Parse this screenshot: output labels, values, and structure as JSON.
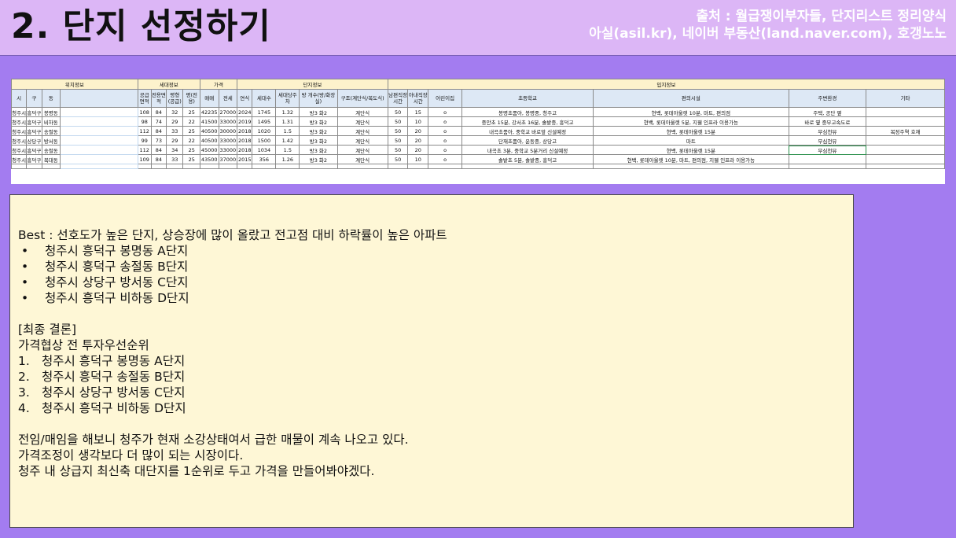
{
  "header": {
    "title": "2. 단지 선정하기",
    "source_line1": "출처 : 월급쟁이부자들, 단지리스트 정리양식",
    "source_line2": "아실(asil.kr), 네이버 부동산(land.naver.com), 호갱노노"
  },
  "table": {
    "group_headers": [
      "위치정보",
      "세대정보",
      "가격",
      "단지정보",
      "입지정보"
    ],
    "columns": [
      "시",
      "구",
      "동",
      "",
      "공급면적",
      "전용면적",
      "평형(공급)",
      "평(전용)",
      "매매",
      "전세",
      "연식",
      "세대수",
      "세대당주차",
      "방 개수(방/화장실)",
      "구조(계단식/복도식)",
      "남편직장시간",
      "아내직장시간",
      "어린이집",
      "초등학교",
      "편의시설",
      "주변환경",
      "기타"
    ],
    "rows": [
      [
        "청주시",
        "흥덕구",
        "봉명동",
        "",
        "108",
        "84",
        "32",
        "25",
        "42235",
        "27000",
        "2024",
        "1745",
        "1.32",
        "방3 화2",
        "계단식",
        "50",
        "15",
        "o",
        "봉명초품아, 봉명중, 청주고",
        "현백, 롯데아울렛 10분, 마트, 편의점",
        "주택, 공단 옆",
        ""
      ],
      [
        "청주시",
        "흥덕구",
        "비하동",
        "",
        "98",
        "74",
        "29",
        "22",
        "41500",
        "33000",
        "2019",
        "1495",
        "1.31",
        "방3 화2",
        "계단식",
        "50",
        "10",
        "o",
        "중안초 15분, 강서초 16분, 솔밭중, 흥덕고",
        "현백, 롯데아울렛 5분, 지웰 인프라 이용가능",
        "바로 옆 중부고속도로",
        ""
      ],
      [
        "청주시",
        "흥덕구",
        "송절동",
        "",
        "112",
        "84",
        "33",
        "25",
        "40500",
        "30000",
        "2018",
        "1020",
        "1.5",
        "방3 화2",
        "계단식",
        "50",
        "20",
        "o",
        "내곡초품아, 중학교 바로앞 신설예정",
        "현백, 롯데아울렛 15분",
        "무심천뷰",
        "복정주역 호재"
      ],
      [
        "청주시",
        "상당구",
        "방서동",
        "",
        "99",
        "73",
        "29",
        "22",
        "40500",
        "33000",
        "2018",
        "1500",
        "1.42",
        "방3 화2",
        "계단식",
        "50",
        "20",
        "o",
        "단재초품아, 운동중, 상당고",
        "마트",
        "무심천뷰",
        ""
      ],
      [
        "청주시",
        "흥덕구",
        "송절동",
        "",
        "112",
        "84",
        "34",
        "25",
        "45000",
        "33000",
        "2018",
        "1034",
        "1.5",
        "방3 화2",
        "계단식",
        "50",
        "20",
        "o",
        "내곡초 3분, 중학교 5분거리 신설예정",
        "현백, 롯데아울렛 15분",
        "무심천뷰",
        ""
      ],
      [
        "청주시",
        "흥덕구",
        "복대동",
        "",
        "109",
        "84",
        "33",
        "25",
        "43500",
        "37000",
        "2015",
        "356",
        "1.26",
        "방3 화2",
        "계단식",
        "50",
        "10",
        "o",
        "솔밭초 5분, 솔밭중, 흥덕고",
        "현백, 롯데아울렛 10분, 마트, 편의점, 지웰 인프라 이용가능",
        "",
        ""
      ]
    ]
  },
  "summary": {
    "best_heading": "Best : 선호도가 높은 단지, 상승장에 많이 올랐고 전고점 대비 하락률이 높은 아파트",
    "best_items": [
      "청주시 흥덕구 봉명동 A단지",
      "청주시 흥덕구 송절동 B단지",
      "청주시 상당구 방서동 C단지",
      "청주시 흥덕구 비하동 D단지"
    ],
    "conclusion_heading": "[최종 결론]",
    "conclusion_sub": "가격협상 전 투자우선순위",
    "ranked_items": [
      "청주시 흥덕구 봉명동 A단지",
      "청주시 흥덕구 송절동 B단지",
      "청주시 상당구 방서동 C단지",
      "청주시 흥덕구 비하동 D단지"
    ],
    "notes": [
      "전임/매임을 해보니 청주가 현재 소강상태여서 급한 매물이 계속 나오고 있다.",
      "가격조정이 생각보다 더 많이 되는 시장이다.",
      "청주 내 상급지 최신축 대단지를 1순위로 두고 가격을 만들어봐야겠다."
    ]
  }
}
